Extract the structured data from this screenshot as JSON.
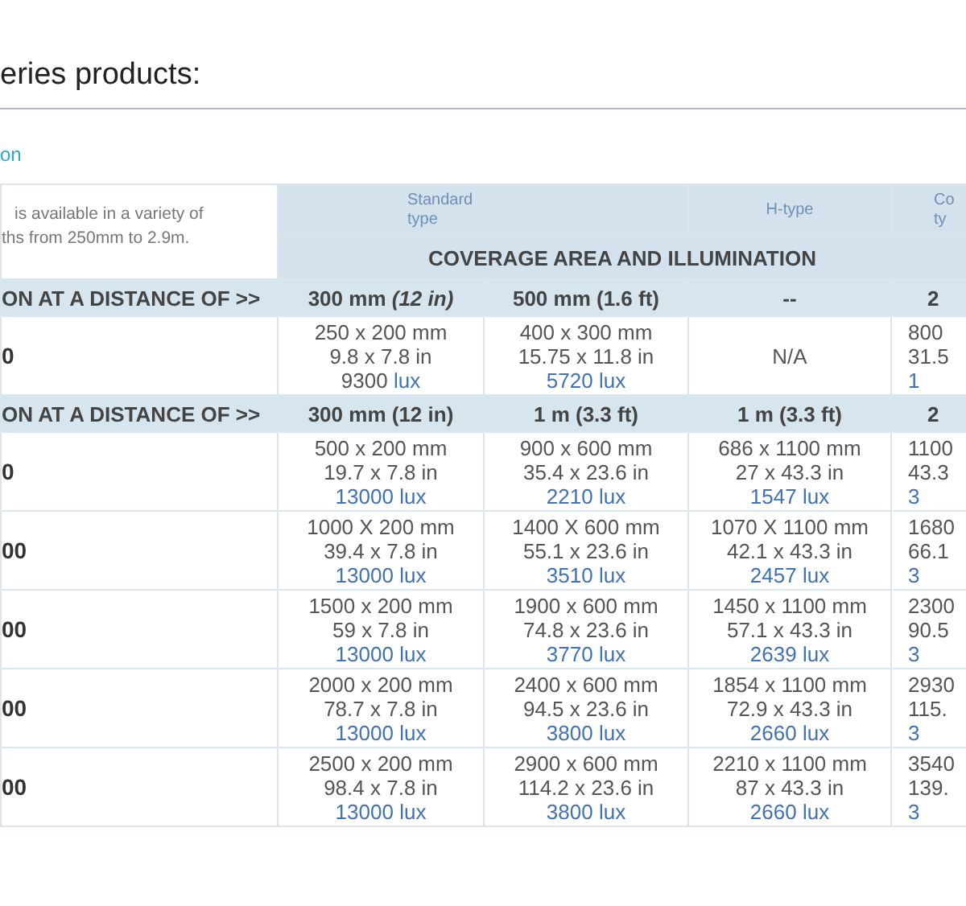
{
  "heading": "eries products:",
  "link": "on",
  "table": {
    "description": [
      "is available in a variety of",
      "ths from 250mm to 2.9m."
    ],
    "type_headers": [
      {
        "lines": [
          "Standard",
          "type"
        ]
      },
      {
        "lines": [
          "H-type"
        ]
      },
      {
        "lines": [
          "Co",
          "ty"
        ]
      }
    ],
    "section_title": "COVERAGE AREA AND ILLUMINATION",
    "groups": [
      {
        "distance_label": "ON AT A DISTANCE OF >>",
        "distances": [
          "300 mm *(12 in)*",
          "500 mm (1.6 ft)",
          "--",
          "2"
        ],
        "rows": [
          {
            "model": "0",
            "cells": [
              {
                "kind": "spec",
                "mm": "250 x 200 mm",
                "in": "9.8 x 7.8 in",
                "lux": "9300",
                "unit": "lux",
                "number_blue": false
              },
              {
                "kind": "spec",
                "mm": "400 x 300 mm",
                "in": "15.75 x 11.8 in",
                "lux": "5720",
                "unit": "lux",
                "number_blue": true
              },
              {
                "kind": "na",
                "text": "N/A"
              },
              {
                "kind": "spec",
                "mm": "800",
                "in": "31.5",
                "lux": "1",
                "number_blue": true
              }
            ]
          }
        ]
      },
      {
        "distance_label": "ON AT A DISTANCE OF >>",
        "distances": [
          "300 mm (12 in)",
          "1 m (3.3 ft)",
          "1 m (3.3 ft)",
          "2"
        ],
        "rows": [
          {
            "model": "0",
            "cells": [
              {
                "kind": "spec",
                "mm": "500 x 200 mm",
                "in": "19.7 x 7.8 in",
                "lux": "13000",
                "unit": "lux",
                "number_blue": true
              },
              {
                "kind": "spec",
                "mm": "900 x 600 mm",
                "in": "35.4 x 23.6 in",
                "lux": "2210",
                "unit": "lux",
                "number_blue": true
              },
              {
                "kind": "spec",
                "mm": "686 x 1100 mm",
                "in": "27 x 43.3 in",
                "lux": "1547",
                "unit": "lux",
                "number_blue": true
              },
              {
                "kind": "spec",
                "mm": "1100",
                "in": "43.3",
                "lux": "3",
                "number_blue": true
              }
            ]
          },
          {
            "model": "00",
            "cells": [
              {
                "kind": "spec",
                "mm": "1000 X 200 mm",
                "in": "39.4 x 7.8 in",
                "lux": "13000",
                "unit": "lux",
                "number_blue": true
              },
              {
                "kind": "spec",
                "mm": "1400 X 600 mm",
                "in": "55.1 x 23.6 in",
                "lux": "3510",
                "unit": "lux",
                "number_blue": true
              },
              {
                "kind": "spec",
                "mm": "1070 X 1100 mm",
                "in": "42.1 x 43.3 in",
                "lux": "2457",
                "unit": "lux",
                "number_blue": true
              },
              {
                "kind": "spec",
                "mm": "1680",
                "in": "66.1",
                "lux": "3",
                "number_blue": true
              }
            ]
          },
          {
            "model": "00",
            "cells": [
              {
                "kind": "spec",
                "mm": "1500 x 200 mm",
                "in": "59 x 7.8 in",
                "lux": "13000",
                "unit": "lux",
                "number_blue": true
              },
              {
                "kind": "spec",
                "mm": "1900 x 600 mm",
                "in": "74.8 x 23.6 in",
                "lux": "3770",
                "unit": "lux",
                "number_blue": true
              },
              {
                "kind": "spec",
                "mm": "1450 x 1100 mm",
                "in": "57.1 x 43.3 in",
                "lux": "2639",
                "unit": "lux",
                "number_blue": true
              },
              {
                "kind": "spec",
                "mm": "2300",
                "in": "90.5",
                "lux": "3",
                "number_blue": true
              }
            ]
          },
          {
            "model": "00",
            "cells": [
              {
                "kind": "spec",
                "mm": "2000 x 200 mm",
                "in": "78.7 x 7.8 in",
                "lux": "13000",
                "unit": "lux",
                "number_blue": true
              },
              {
                "kind": "spec",
                "mm": "2400 x 600 mm",
                "in": "94.5 x 23.6 in",
                "lux": "3800",
                "unit": "lux",
                "number_blue": true
              },
              {
                "kind": "spec",
                "mm": "1854 x 1100 mm",
                "in": "72.9 x 43.3 in",
                "lux": "2660",
                "unit": "lux",
                "number_blue": true
              },
              {
                "kind": "spec",
                "mm": "2930",
                "in": "115.",
                "lux": "3",
                "number_blue": true
              }
            ]
          },
          {
            "model": "00",
            "cells": [
              {
                "kind": "spec",
                "mm": "2500 x 200 mm",
                "in": "98.4 x 7.8 in",
                "lux": "13000",
                "unit": "lux",
                "number_blue": true
              },
              {
                "kind": "spec",
                "mm": "2900 x 600 mm",
                "in": "114.2 x 23.6 in",
                "lux": "3800",
                "unit": "lux",
                "number_blue": true
              },
              {
                "kind": "spec",
                "mm": "2210 x 1100 mm",
                "in": "87 x 43.3 in",
                "lux": "2660",
                "unit": "lux",
                "number_blue": true
              },
              {
                "kind": "spec",
                "mm": "3540",
                "in": "139.",
                "lux": "3",
                "number_blue": true
              }
            ]
          }
        ]
      }
    ]
  }
}
